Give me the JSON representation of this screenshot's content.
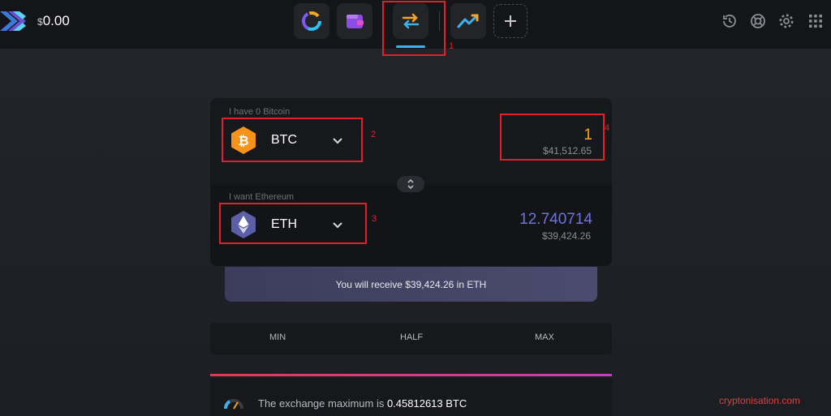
{
  "header": {
    "currency_symbol": "$",
    "balance": "0.00",
    "nav_icons": [
      "portfolio-icon",
      "wallet-icon",
      "exchange-icon",
      "trade-icon",
      "add-icon"
    ],
    "right_icons": [
      "history-icon",
      "support-icon",
      "settings-icon",
      "apps-grid-icon"
    ]
  },
  "exchange": {
    "from": {
      "label": "I have 0 Bitcoin",
      "symbol": "BTC",
      "amount": "1",
      "usd": "$41,512.65"
    },
    "to": {
      "label": "I want Ethereum",
      "symbol": "ETH",
      "amount": "12.740714",
      "usd": "$39,424.26"
    },
    "receive_text": "You will receive $39,424.26 in ETH"
  },
  "amount_buttons": [
    "MIN",
    "HALF",
    "MAX"
  ],
  "max_notice": {
    "text": "The exchange maximum is ",
    "value": "0.45812613 BTC"
  },
  "annotations": [
    "1",
    "2",
    "3",
    "4"
  ],
  "watermark": "cryptonisation.com",
  "colors": {
    "accent_blue": "#3fb0e8",
    "btc_orange": "#f7931a",
    "eth_purple": "#5b5fa8",
    "highlight_red": "#e0202a",
    "amount_orange": "#f5a623",
    "eth_amount": "#6f74d8"
  }
}
